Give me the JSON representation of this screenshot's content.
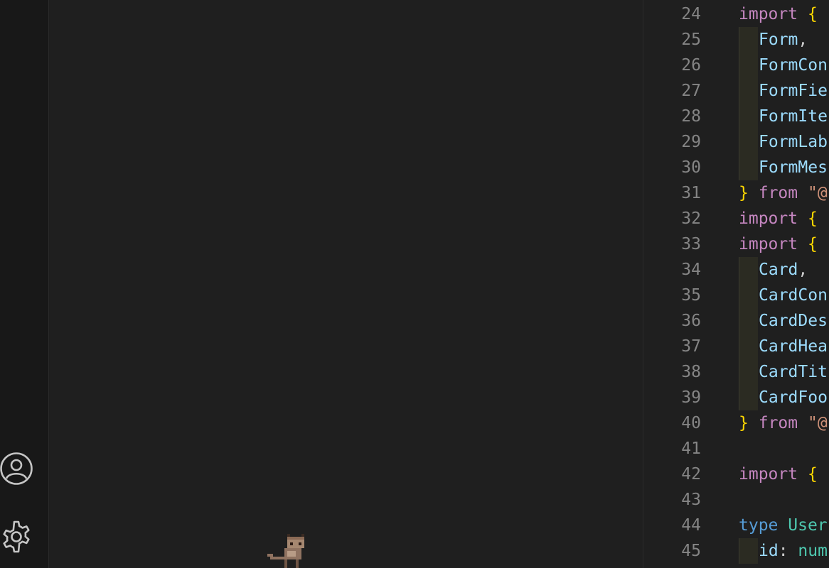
{
  "activity_bar": {
    "icons": [
      "account-icon",
      "settings-gear-icon"
    ]
  },
  "editor": {
    "lines": [
      {
        "n": "24",
        "indent": false,
        "tokens": [
          {
            "t": "import",
            "c": "kw"
          },
          {
            "t": " ",
            "c": "punct"
          },
          {
            "t": "{",
            "c": "brace"
          }
        ]
      },
      {
        "n": "25",
        "indent": true,
        "tokens": [
          {
            "t": "Form",
            "c": "ident"
          },
          {
            "t": ",",
            "c": "punct"
          }
        ]
      },
      {
        "n": "26",
        "indent": true,
        "tokens": [
          {
            "t": "FormCon",
            "c": "ident"
          }
        ]
      },
      {
        "n": "27",
        "indent": true,
        "tokens": [
          {
            "t": "FormFie",
            "c": "ident"
          }
        ]
      },
      {
        "n": "28",
        "indent": true,
        "tokens": [
          {
            "t": "FormIte",
            "c": "ident"
          }
        ]
      },
      {
        "n": "29",
        "indent": true,
        "tokens": [
          {
            "t": "FormLab",
            "c": "ident"
          }
        ]
      },
      {
        "n": "30",
        "indent": true,
        "tokens": [
          {
            "t": "FormMes",
            "c": "ident"
          }
        ]
      },
      {
        "n": "31",
        "indent": false,
        "tokens": [
          {
            "t": "}",
            "c": "brace"
          },
          {
            "t": " ",
            "c": "punct"
          },
          {
            "t": "from",
            "c": "kw"
          },
          {
            "t": " ",
            "c": "punct"
          },
          {
            "t": "\"@",
            "c": "str"
          }
        ]
      },
      {
        "n": "32",
        "indent": false,
        "tokens": [
          {
            "t": "import",
            "c": "kw"
          },
          {
            "t": " ",
            "c": "punct"
          },
          {
            "t": "{",
            "c": "brace"
          }
        ]
      },
      {
        "n": "33",
        "indent": false,
        "tokens": [
          {
            "t": "import",
            "c": "kw"
          },
          {
            "t": " ",
            "c": "punct"
          },
          {
            "t": "{",
            "c": "brace"
          }
        ]
      },
      {
        "n": "34",
        "indent": true,
        "tokens": [
          {
            "t": "Card",
            "c": "ident"
          },
          {
            "t": ",",
            "c": "punct"
          }
        ]
      },
      {
        "n": "35",
        "indent": true,
        "tokens": [
          {
            "t": "CardCon",
            "c": "ident"
          }
        ]
      },
      {
        "n": "36",
        "indent": true,
        "tokens": [
          {
            "t": "CardDes",
            "c": "ident"
          }
        ]
      },
      {
        "n": "37",
        "indent": true,
        "tokens": [
          {
            "t": "CardHea",
            "c": "ident"
          }
        ]
      },
      {
        "n": "38",
        "indent": true,
        "tokens": [
          {
            "t": "CardTit",
            "c": "ident"
          }
        ]
      },
      {
        "n": "39",
        "indent": true,
        "tokens": [
          {
            "t": "CardFoo",
            "c": "ident"
          }
        ]
      },
      {
        "n": "40",
        "indent": false,
        "tokens": [
          {
            "t": "}",
            "c": "brace"
          },
          {
            "t": " ",
            "c": "punct"
          },
          {
            "t": "from",
            "c": "kw"
          },
          {
            "t": " ",
            "c": "punct"
          },
          {
            "t": "\"@",
            "c": "str"
          }
        ]
      },
      {
        "n": "41",
        "indent": false,
        "tokens": []
      },
      {
        "n": "42",
        "indent": false,
        "tokens": [
          {
            "t": "import",
            "c": "kw"
          },
          {
            "t": " ",
            "c": "punct"
          },
          {
            "t": "{",
            "c": "brace"
          }
        ]
      },
      {
        "n": "43",
        "indent": false,
        "tokens": []
      },
      {
        "n": "44",
        "indent": false,
        "tokens": [
          {
            "t": "type",
            "c": "type-kw"
          },
          {
            "t": " ",
            "c": "punct"
          },
          {
            "t": "User",
            "c": "type-name"
          }
        ]
      },
      {
        "n": "45",
        "indent": true,
        "tokens": [
          {
            "t": "id",
            "c": "ident"
          },
          {
            "t": ":",
            "c": "punct"
          },
          {
            "t": " ",
            "c": "punct"
          },
          {
            "t": "num",
            "c": "type-name"
          }
        ]
      }
    ]
  },
  "colors": {
    "keyword": "#c586c0",
    "brace": "#ffd700",
    "identifier": "#9cdcfe",
    "string": "#ce9178",
    "line_number": "#858585"
  }
}
